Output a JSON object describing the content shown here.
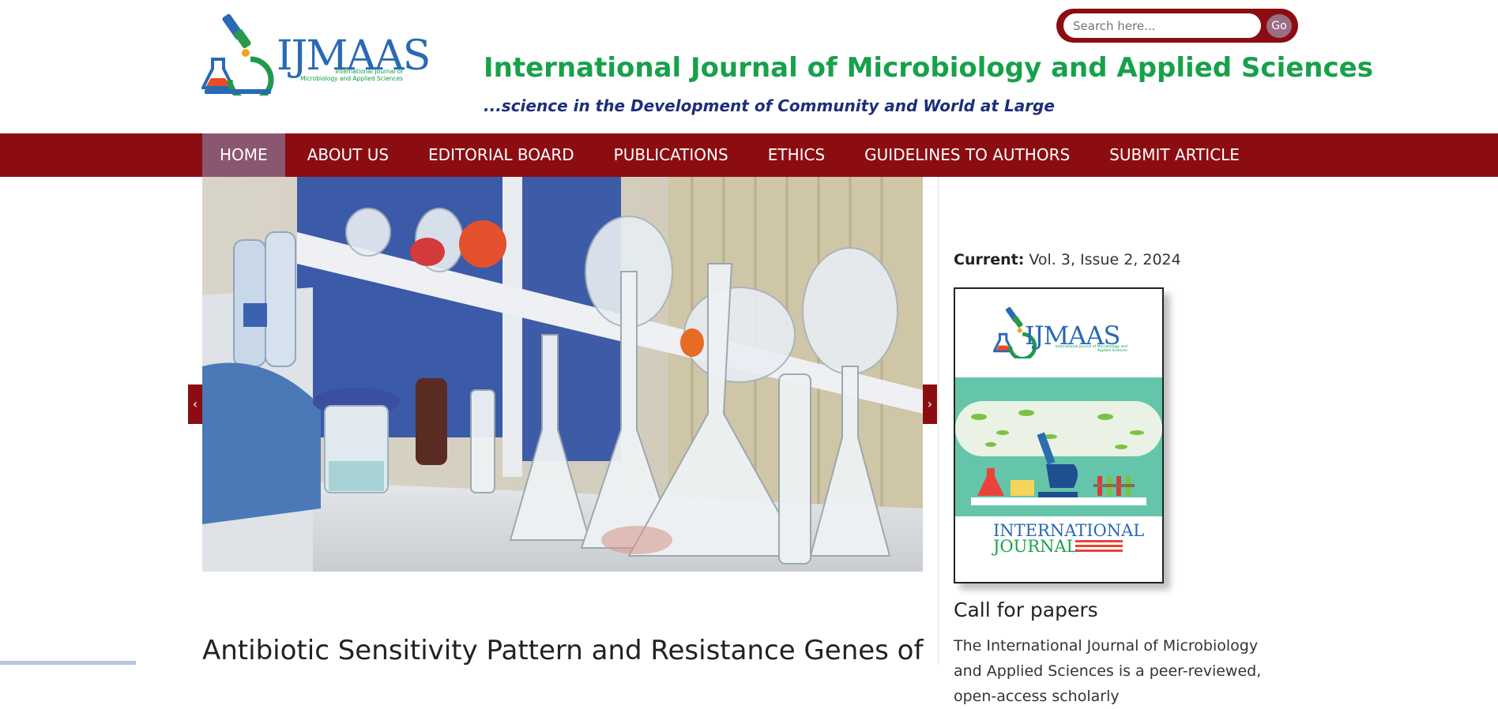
{
  "header": {
    "logo_text": "IJMAAS",
    "logo_subtitle": "International Journal of Microbiology and Applied Sciences",
    "title": "International Journal of Microbiology and Applied Sciences",
    "tagline": "...science in the Development of Community and World at Large"
  },
  "search": {
    "placeholder": "Search here...",
    "button_label": "Go"
  },
  "nav": {
    "items": [
      {
        "label": "HOME",
        "active": true
      },
      {
        "label": "ABOUT US"
      },
      {
        "label": "EDITORIAL BOARD"
      },
      {
        "label": "PUBLICATIONS"
      },
      {
        "label": "ETHICS"
      },
      {
        "label": "GUIDELINES TO AUTHORS"
      },
      {
        "label": "SUBMIT ARTICLE"
      }
    ]
  },
  "slider": {
    "prev_icon": "chevron-left-icon",
    "next_icon": "chevron-right-icon"
  },
  "article": {
    "title": "Antibiotic Sensitivity Pattern and Resistance Genes of"
  },
  "sidebar": {
    "current_label": "Current:",
    "current_value": " Vol. 3, Issue 2, 2024",
    "cover": {
      "logo_text": "IJMAAS",
      "logo_subtitle": "International Journal of Microbiology and Applied Sciences",
      "title_line1": "INTERNATIONAL",
      "title_line2": "JOURNAL"
    },
    "call_title": "Call for papers",
    "call_text": "The International Journal of Microbiology and Applied Sciences is a peer-reviewed, open-access scholarly"
  },
  "colors": {
    "nav_bg": "#8b0d12",
    "nav_active": "#8a5670",
    "title_green": "#17a14a",
    "tagline_blue": "#1d2f7a"
  }
}
